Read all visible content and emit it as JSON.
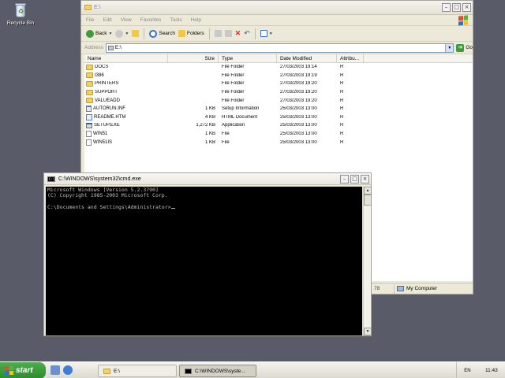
{
  "desktop": {
    "recycle_bin_label": "Recycle Bin"
  },
  "explorer": {
    "title": "E:\\",
    "menu": [
      "File",
      "Edit",
      "View",
      "Favorites",
      "Tools",
      "Help"
    ],
    "toolbar": {
      "back_label": "Back",
      "search_label": "Search",
      "folders_label": "Folders"
    },
    "address": {
      "label": "Address",
      "value": "E:\\",
      "go_label": "Go"
    },
    "columns": [
      "Name",
      "Size",
      "Type",
      "Date Modified",
      "Attribu..."
    ],
    "rows": [
      {
        "name": "DOCS",
        "size": "",
        "type": "File Folder",
        "date": "27/03/2003 19:14",
        "attr": "R",
        "icon": "folder-icon"
      },
      {
        "name": "I386",
        "size": "",
        "type": "File Folder",
        "date": "27/03/2003 19:19",
        "attr": "R",
        "icon": "folder-icon"
      },
      {
        "name": "PRINTERS",
        "size": "",
        "type": "File Folder",
        "date": "27/03/2003 19:20",
        "attr": "R",
        "icon": "folder-icon"
      },
      {
        "name": "SUPPORT",
        "size": "",
        "type": "File Folder",
        "date": "27/03/2003 19:20",
        "attr": "R",
        "icon": "folder-icon"
      },
      {
        "name": "VALUEADD",
        "size": "",
        "type": "File Folder",
        "date": "27/03/2003 19:20",
        "attr": "R",
        "icon": "folder-icon"
      },
      {
        "name": "AUTORUN.INF",
        "size": "1 KB",
        "type": "Setup Information",
        "date": "25/03/2003 13:00",
        "attr": "R",
        "icon": "setup-info-icon"
      },
      {
        "name": "README.HTM",
        "size": "4 KB",
        "type": "HTML Document",
        "date": "25/03/2003 13:00",
        "attr": "R",
        "icon": "html-document-icon"
      },
      {
        "name": "SETUP.EXE",
        "size": "1,272 KB",
        "type": "Application",
        "date": "25/03/2003 13:00",
        "attr": "R",
        "icon": "application-icon"
      },
      {
        "name": "WIN51",
        "size": "1 KB",
        "type": "File",
        "date": "25/03/2003 13:00",
        "attr": "R",
        "icon": "file-icon"
      },
      {
        "name": "WIN51IS",
        "size": "1 KB",
        "type": "File",
        "date": "25/03/2003 13:00",
        "attr": "R",
        "icon": "file-icon"
      }
    ],
    "status": {
      "partial": "78",
      "location": "My Computer"
    }
  },
  "cmd": {
    "title": "C:\\WINDOWS\\system32\\cmd.exe",
    "lines": [
      "Microsoft Windows [Version 5.2.3790]",
      "(C) Copyright 1985-2003 Microsoft Corp.",
      "",
      "C:\\Documents and Settings\\Administrator>"
    ]
  },
  "taskbar": {
    "start_label": "start",
    "buttons": [
      {
        "label": "E:\\",
        "icon": "folder-icon"
      },
      {
        "label": "C:\\WINDOWS\\syste...",
        "icon": "console-icon"
      }
    ],
    "language": "EN",
    "clock": "11:43"
  }
}
